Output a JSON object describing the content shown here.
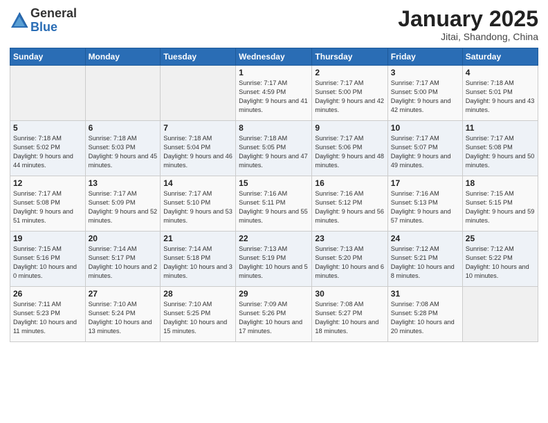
{
  "header": {
    "logo_general": "General",
    "logo_blue": "Blue",
    "month_title": "January 2025",
    "location": "Jitai, Shandong, China"
  },
  "weekdays": [
    "Sunday",
    "Monday",
    "Tuesday",
    "Wednesday",
    "Thursday",
    "Friday",
    "Saturday"
  ],
  "weeks": [
    [
      {
        "day": "",
        "info": ""
      },
      {
        "day": "",
        "info": ""
      },
      {
        "day": "",
        "info": ""
      },
      {
        "day": "1",
        "info": "Sunrise: 7:17 AM\nSunset: 4:59 PM\nDaylight: 9 hours and 41 minutes."
      },
      {
        "day": "2",
        "info": "Sunrise: 7:17 AM\nSunset: 5:00 PM\nDaylight: 9 hours and 42 minutes."
      },
      {
        "day": "3",
        "info": "Sunrise: 7:17 AM\nSunset: 5:00 PM\nDaylight: 9 hours and 42 minutes."
      },
      {
        "day": "4",
        "info": "Sunrise: 7:18 AM\nSunset: 5:01 PM\nDaylight: 9 hours and 43 minutes."
      }
    ],
    [
      {
        "day": "5",
        "info": "Sunrise: 7:18 AM\nSunset: 5:02 PM\nDaylight: 9 hours and 44 minutes."
      },
      {
        "day": "6",
        "info": "Sunrise: 7:18 AM\nSunset: 5:03 PM\nDaylight: 9 hours and 45 minutes."
      },
      {
        "day": "7",
        "info": "Sunrise: 7:18 AM\nSunset: 5:04 PM\nDaylight: 9 hours and 46 minutes."
      },
      {
        "day": "8",
        "info": "Sunrise: 7:18 AM\nSunset: 5:05 PM\nDaylight: 9 hours and 47 minutes."
      },
      {
        "day": "9",
        "info": "Sunrise: 7:17 AM\nSunset: 5:06 PM\nDaylight: 9 hours and 48 minutes."
      },
      {
        "day": "10",
        "info": "Sunrise: 7:17 AM\nSunset: 5:07 PM\nDaylight: 9 hours and 49 minutes."
      },
      {
        "day": "11",
        "info": "Sunrise: 7:17 AM\nSunset: 5:08 PM\nDaylight: 9 hours and 50 minutes."
      }
    ],
    [
      {
        "day": "12",
        "info": "Sunrise: 7:17 AM\nSunset: 5:08 PM\nDaylight: 9 hours and 51 minutes."
      },
      {
        "day": "13",
        "info": "Sunrise: 7:17 AM\nSunset: 5:09 PM\nDaylight: 9 hours and 52 minutes."
      },
      {
        "day": "14",
        "info": "Sunrise: 7:17 AM\nSunset: 5:10 PM\nDaylight: 9 hours and 53 minutes."
      },
      {
        "day": "15",
        "info": "Sunrise: 7:16 AM\nSunset: 5:11 PM\nDaylight: 9 hours and 55 minutes."
      },
      {
        "day": "16",
        "info": "Sunrise: 7:16 AM\nSunset: 5:12 PM\nDaylight: 9 hours and 56 minutes."
      },
      {
        "day": "17",
        "info": "Sunrise: 7:16 AM\nSunset: 5:13 PM\nDaylight: 9 hours and 57 minutes."
      },
      {
        "day": "18",
        "info": "Sunrise: 7:15 AM\nSunset: 5:15 PM\nDaylight: 9 hours and 59 minutes."
      }
    ],
    [
      {
        "day": "19",
        "info": "Sunrise: 7:15 AM\nSunset: 5:16 PM\nDaylight: 10 hours and 0 minutes."
      },
      {
        "day": "20",
        "info": "Sunrise: 7:14 AM\nSunset: 5:17 PM\nDaylight: 10 hours and 2 minutes."
      },
      {
        "day": "21",
        "info": "Sunrise: 7:14 AM\nSunset: 5:18 PM\nDaylight: 10 hours and 3 minutes."
      },
      {
        "day": "22",
        "info": "Sunrise: 7:13 AM\nSunset: 5:19 PM\nDaylight: 10 hours and 5 minutes."
      },
      {
        "day": "23",
        "info": "Sunrise: 7:13 AM\nSunset: 5:20 PM\nDaylight: 10 hours and 6 minutes."
      },
      {
        "day": "24",
        "info": "Sunrise: 7:12 AM\nSunset: 5:21 PM\nDaylight: 10 hours and 8 minutes."
      },
      {
        "day": "25",
        "info": "Sunrise: 7:12 AM\nSunset: 5:22 PM\nDaylight: 10 hours and 10 minutes."
      }
    ],
    [
      {
        "day": "26",
        "info": "Sunrise: 7:11 AM\nSunset: 5:23 PM\nDaylight: 10 hours and 11 minutes."
      },
      {
        "day": "27",
        "info": "Sunrise: 7:10 AM\nSunset: 5:24 PM\nDaylight: 10 hours and 13 minutes."
      },
      {
        "day": "28",
        "info": "Sunrise: 7:10 AM\nSunset: 5:25 PM\nDaylight: 10 hours and 15 minutes."
      },
      {
        "day": "29",
        "info": "Sunrise: 7:09 AM\nSunset: 5:26 PM\nDaylight: 10 hours and 17 minutes."
      },
      {
        "day": "30",
        "info": "Sunrise: 7:08 AM\nSunset: 5:27 PM\nDaylight: 10 hours and 18 minutes."
      },
      {
        "day": "31",
        "info": "Sunrise: 7:08 AM\nSunset: 5:28 PM\nDaylight: 10 hours and 20 minutes."
      },
      {
        "day": "",
        "info": ""
      }
    ]
  ]
}
